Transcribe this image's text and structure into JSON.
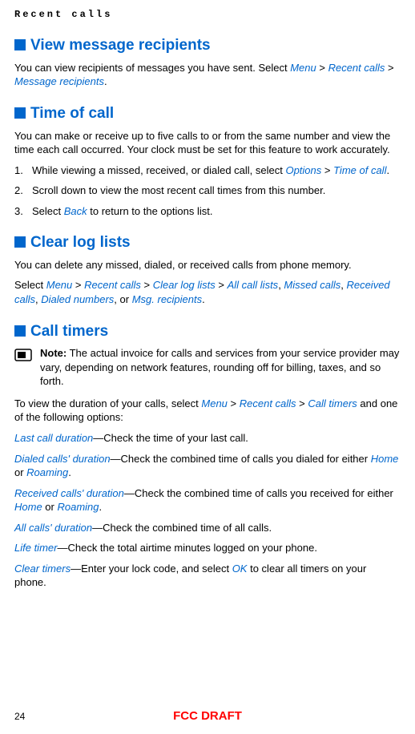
{
  "header": "Recent calls",
  "sections": {
    "viewMsg": {
      "title": "View message recipients",
      "body1a": "You can view recipients of messages you have sent. Select ",
      "menu": "Menu",
      "gt1": " > ",
      "recent": "Recent calls",
      "gt2": " > ",
      "msgRecip": "Message recipients",
      "period": "."
    },
    "timeOfCall": {
      "title": "Time of call",
      "body": "You can make or receive up to five calls to or from the same number and view the time each call occurred. Your clock must be set for this feature to work accurately.",
      "step1a": "While viewing a missed, received, or dialed call, select ",
      "step1Options": "Options",
      "step1gt": " > ",
      "step1Time": "Time of call",
      "step1end": ".",
      "step2": "Scroll down to view the most recent call times from this number.",
      "step3a": "Select ",
      "step3Back": "Back",
      "step3b": " to return to the options list."
    },
    "clearLog": {
      "title": "Clear log lists",
      "body": "You can delete any missed, dialed, or received calls from phone memory.",
      "s2a": "Select ",
      "s2menu": "Menu",
      "s2gt1": " > ",
      "s2recent": "Recent calls",
      "s2gt2": " > ",
      "s2clear": "Clear log lists",
      "s2gt3": " > ",
      "s2all": "All call lists",
      "s2c1": ", ",
      "s2missed": "Missed calls",
      "s2c2": ", ",
      "s2received": "Received calls",
      "s2c3": ", ",
      "s2dialed": "Dialed numbers",
      "s2or": ", or ",
      "s2msg": "Msg. recipients",
      "s2end": "."
    },
    "callTimers": {
      "title": "Call timers",
      "noteLabel": "Note:",
      "noteBody": " The actual invoice for calls and services from your service provider may vary, depending on network features, rounding off for billing, taxes, and so forth.",
      "viewA": "To view the duration of your calls, select ",
      "viewMenu": "Menu",
      "viewGt1": " > ",
      "viewRecent": "Recent calls",
      "viewGt2": " > ",
      "viewTimers": "Call timers",
      "viewB": " and one of the following options:",
      "opt1a": "Last call duration",
      "opt1b": "—Check the time of your last call.",
      "opt2a": "Dialed calls' duration",
      "opt2b": "—Check the combined time of calls you dialed for either ",
      "opt2Home": "Home",
      "opt2or": " or ",
      "opt2Roaming": "Roaming",
      "opt2end": ".",
      "opt3a": "Received calls' duration",
      "opt3b": "—Check the combined time of calls you received for either ",
      "opt3Home": "Home",
      "opt3or": " or ",
      "opt3Roaming": "Roaming",
      "opt3end": ".",
      "opt4a": "All calls' duration",
      "opt4b": "—Check the combined time of all calls.",
      "opt5a": "Life timer",
      "opt5b": "—Check the total airtime minutes logged on your phone.",
      "opt6a": "Clear timers",
      "opt6b": "—Enter your lock code, and select ",
      "opt6OK": "OK",
      "opt6c": " to clear all timers on your phone."
    }
  },
  "footer": {
    "page": "24",
    "fcc": "FCC DRAFT"
  }
}
